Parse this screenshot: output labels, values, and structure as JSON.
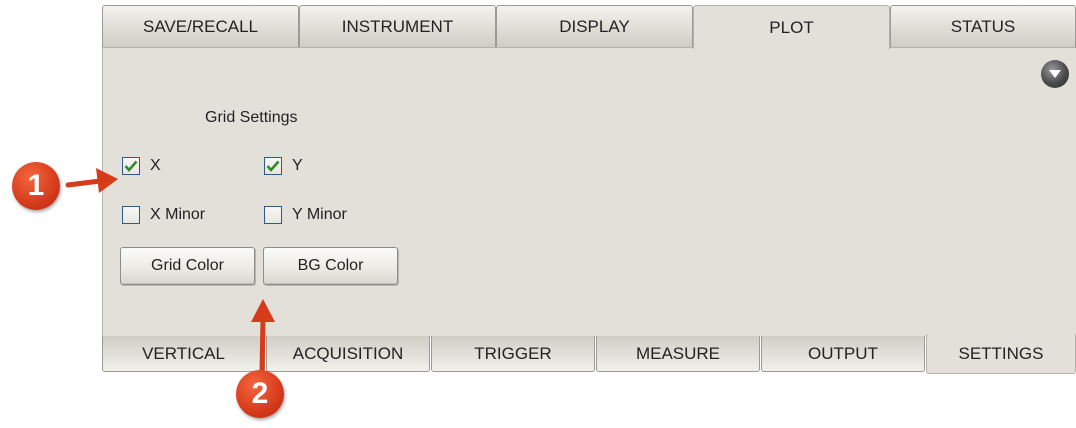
{
  "top_tabs": [
    {
      "label": "SAVE/RECALL"
    },
    {
      "label": "INSTRUMENT"
    },
    {
      "label": "DISPLAY"
    },
    {
      "label": "PLOT"
    },
    {
      "label": "STATUS"
    }
  ],
  "active_top_tab": "PLOT",
  "panel": {
    "title": "Grid Settings",
    "checkboxes": {
      "x": {
        "label": "X",
        "checked": true
      },
      "y": {
        "label": "Y",
        "checked": true
      },
      "x_minor": {
        "label": "X Minor",
        "checked": false
      },
      "y_minor": {
        "label": "Y Minor",
        "checked": false
      }
    },
    "buttons": {
      "grid_color": "Grid Color",
      "bg_color": "BG Color"
    }
  },
  "bottom_tabs": [
    {
      "label": "VERTICAL"
    },
    {
      "label": "ACQUISITION"
    },
    {
      "label": "TRIGGER"
    },
    {
      "label": "MEASURE"
    },
    {
      "label": "OUTPUT"
    },
    {
      "label": "SETTINGS"
    }
  ],
  "active_bottom_tab": "SETTINGS",
  "callouts": {
    "one": "1",
    "two": "2"
  },
  "colors": {
    "callout": "#d63b1a",
    "panel_bg": "#e3e0da",
    "checkmark": "#2e8b2e"
  },
  "icons": {
    "scroll": "down-triangle-circle-icon",
    "check": "checkmark-icon"
  }
}
